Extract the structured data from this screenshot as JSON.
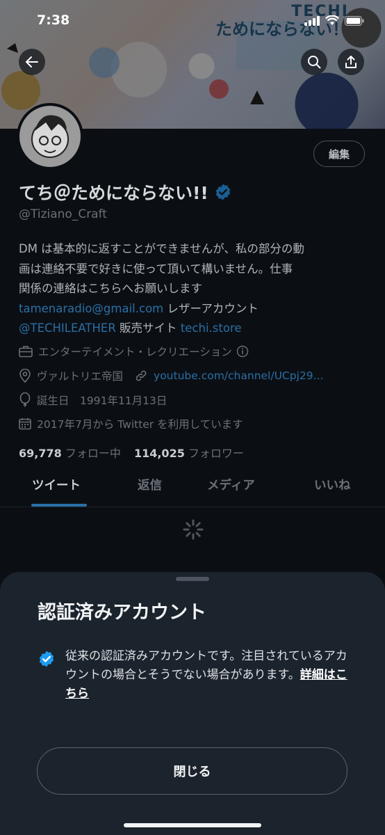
{
  "status_bar": {
    "time": "7:38"
  },
  "banner": {
    "text_line1": "TECHI",
    "text_line2": "ためにならない！"
  },
  "profile": {
    "edit_label": "編集",
    "display_name": "てち＠ためにならない!!",
    "handle": "@Tiziano_Craft",
    "bio": {
      "line1": "DM は基本的に返すことができませんが、私の部分の動",
      "line2": "画は連絡不要で好きに使って頂いて構いません。仕事",
      "line3": "関係の連絡はこちらへお願いします",
      "email": "tamenaradio@gmail.com",
      "after_email": " レザーアカウント",
      "leather_handle": "@TECHILEATHER",
      "shop_label": " 販売サイト ",
      "shop_link": "techi.store"
    },
    "category": "エンターテイメント・レクリエーション",
    "location": "ヴァルトリエ帝国",
    "website": "youtube.com/channel/UCpj29...",
    "birthday": "誕生日　1991年11月13日",
    "joined": "2017年7月から Twitter を利用しています",
    "following_count": "69,778",
    "following_label": "フォロー中",
    "followers_count": "114,025",
    "followers_label": "フォロワー"
  },
  "tabs": [
    {
      "label": "ツイート",
      "active": true
    },
    {
      "label": "返信",
      "active": false
    },
    {
      "label": "メディア",
      "active": false
    },
    {
      "label": "いいね",
      "active": false
    }
  ],
  "sheet": {
    "title": "認証済みアカウント",
    "description": "従来の認証済みアカウントです。注目されているアカウントの場合とそうでない場合があります。",
    "detail_link": "詳細はこちら",
    "close_label": "閉じる"
  },
  "colors": {
    "accent": "#1d9bf0",
    "background": "#0b0f14",
    "sheet_background": "#1b232d"
  },
  "icons": {
    "back": "arrow-left-icon",
    "search": "search-icon",
    "share": "share-icon",
    "verified": "verified-badge-icon",
    "category": "briefcase-icon",
    "location": "location-pin-icon",
    "link": "link-icon",
    "birthday": "balloon-icon",
    "joined": "calendar-icon"
  }
}
